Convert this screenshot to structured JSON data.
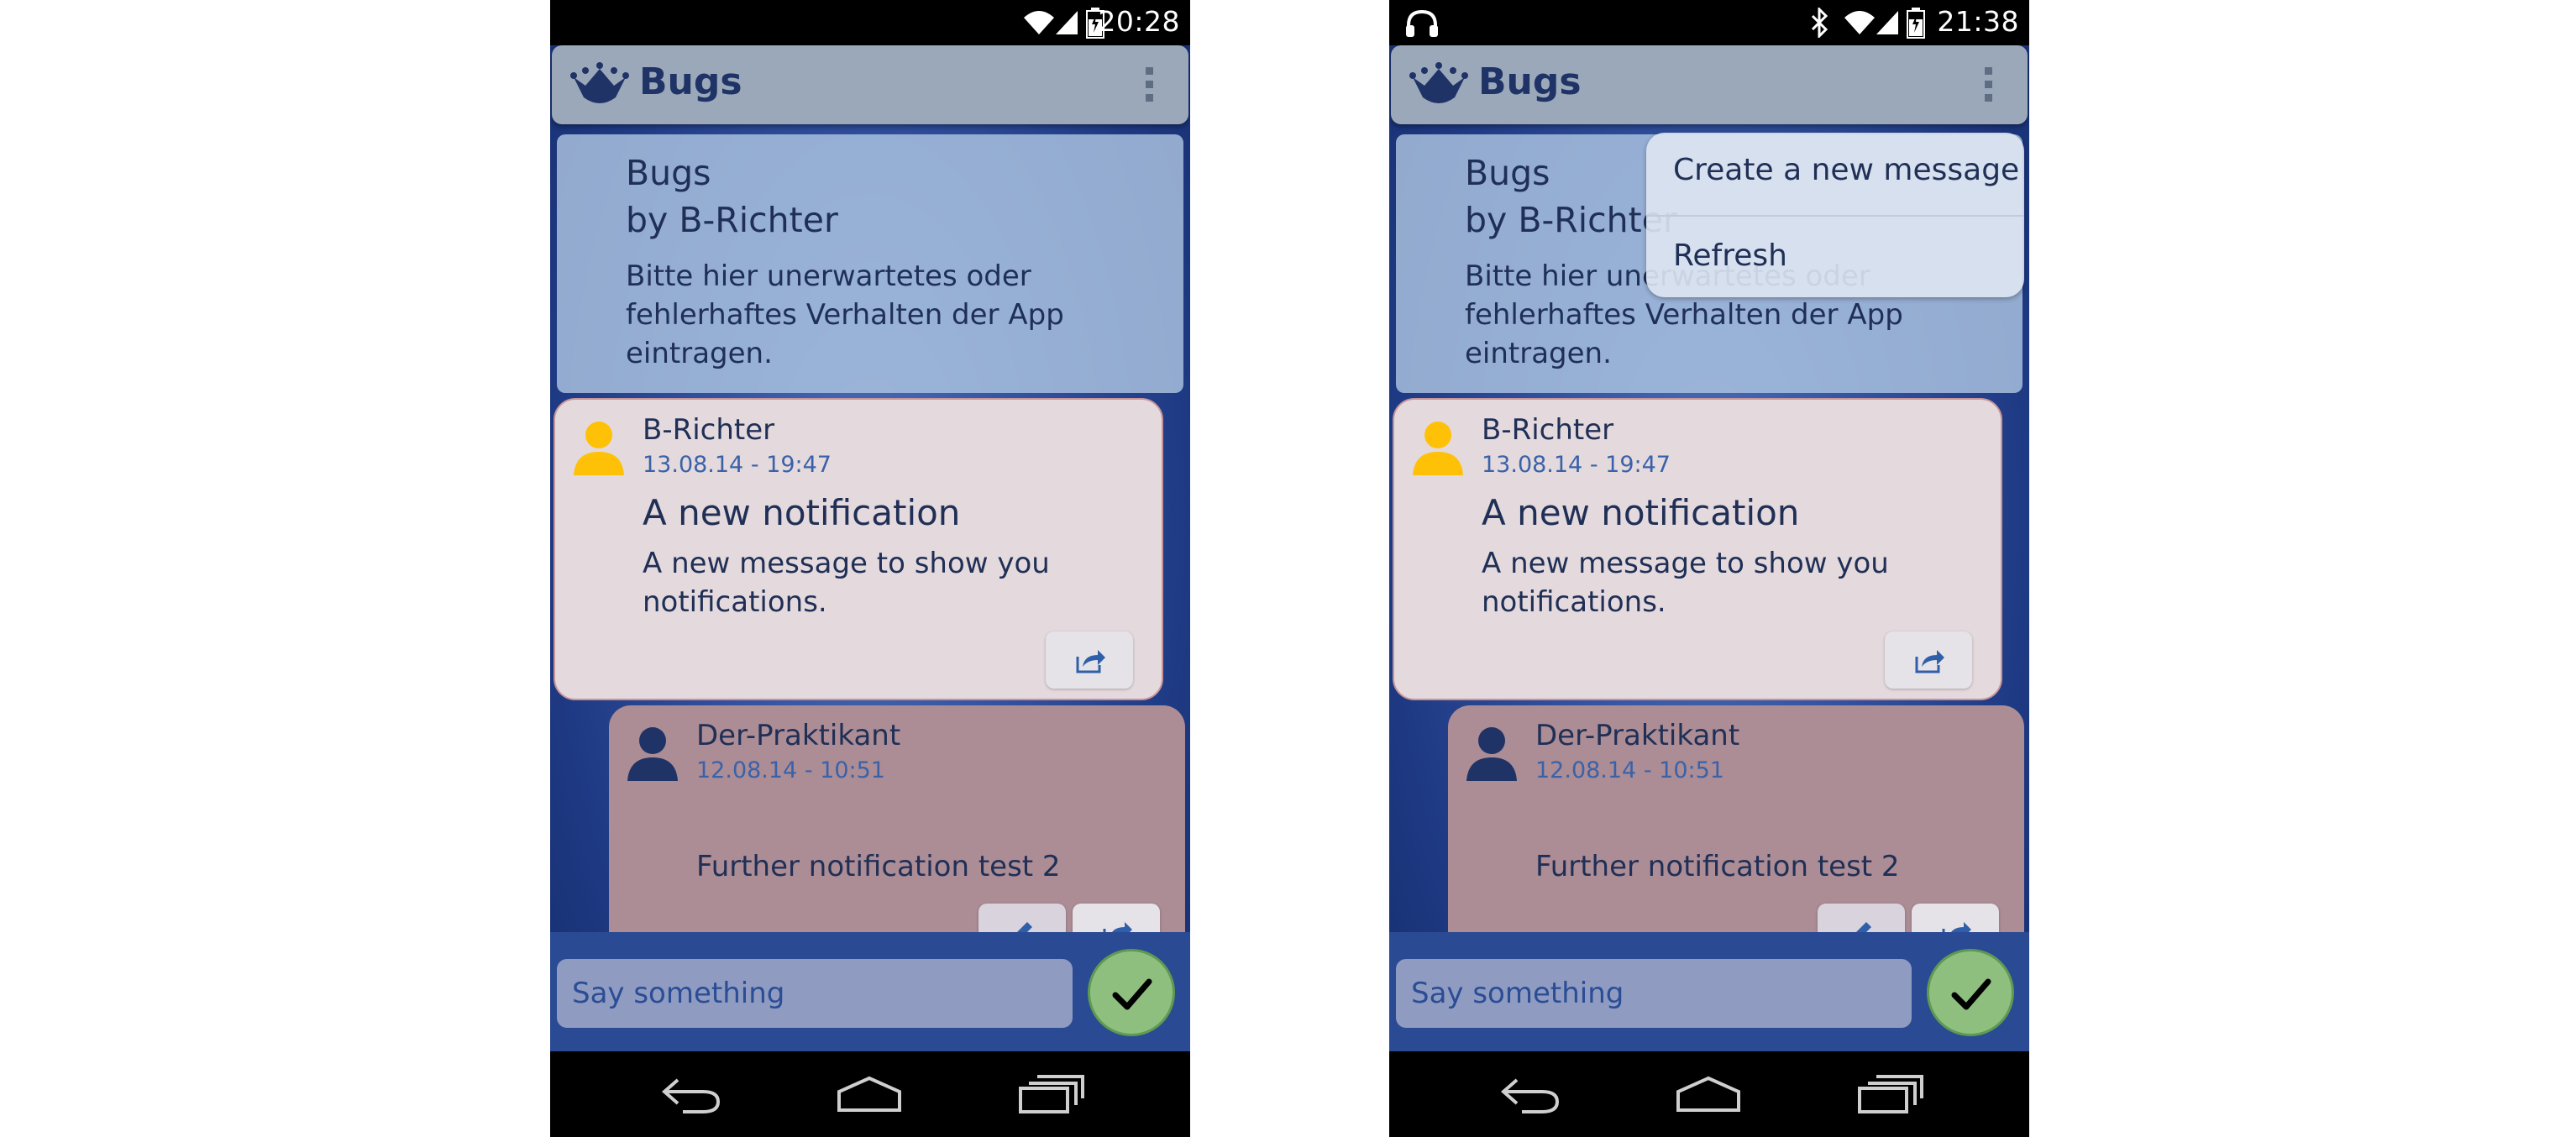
{
  "screens": [
    {
      "status": {
        "time": "20:28"
      },
      "app": {
        "title": "Bugs"
      },
      "header": {
        "title_line1": "Bugs",
        "title_line2": "by B-Richter",
        "description": "Bitte hier unerwartetes oder fehlerhaftes Verhalten der App eintragen."
      },
      "messages": [
        {
          "author": "B-Richter",
          "date": "13.08.14 - 19:47",
          "title": "A new notification",
          "body": "A new message to show you notifications.",
          "avatar_color": "#ffc107"
        },
        {
          "author": "Der-Praktikant",
          "date": "12.08.14 - 10:51",
          "body": "Further notification test 2",
          "avatar_color": "#1f3366"
        }
      ],
      "input": {
        "placeholder": "Say something"
      }
    },
    {
      "status": {
        "time": "21:38"
      },
      "app": {
        "title": "Bugs"
      },
      "header": {
        "title_line1": "Bugs",
        "title_line2": "by B-Richter",
        "description": "Bitte hier unerwartetes oder fehlerhaftes Verhalten der App eintragen."
      },
      "messages": [
        {
          "author": "B-Richter",
          "date": "13.08.14 - 19:47",
          "title": "A new notification",
          "body": "A new message to show you notifications.",
          "avatar_color": "#ffc107"
        },
        {
          "author": "Der-Praktikant",
          "date": "12.08.14 - 10:51",
          "body": "Further notification test 2",
          "avatar_color": "#1f3366"
        }
      ],
      "input": {
        "placeholder": "Say something"
      },
      "menu": {
        "items": [
          "Create a new message",
          "Refresh"
        ]
      }
    }
  ],
  "colors": {
    "accent": "#1f3366",
    "send_button": "#8fbf7f",
    "action_bar": "#9aa8ba"
  }
}
